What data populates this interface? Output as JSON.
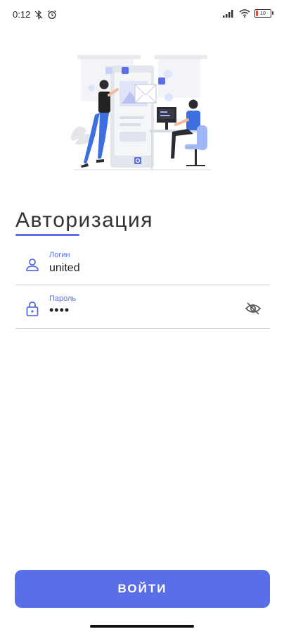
{
  "status_bar": {
    "time": "0:12",
    "battery_level": "10"
  },
  "header": {
    "title": "Авторизация"
  },
  "form": {
    "login": {
      "label": "Логин",
      "value": "united"
    },
    "password": {
      "label": "Пароль",
      "value": "••••"
    }
  },
  "actions": {
    "submit_label": "ВОЙТИ"
  },
  "colors": {
    "accent": "#5a6ee8",
    "text": "#333333",
    "divider": "#cfcfcf"
  },
  "icons": {
    "login_field": "user-icon",
    "password_field": "lock-icon",
    "password_toggle": "eye-off-icon"
  }
}
